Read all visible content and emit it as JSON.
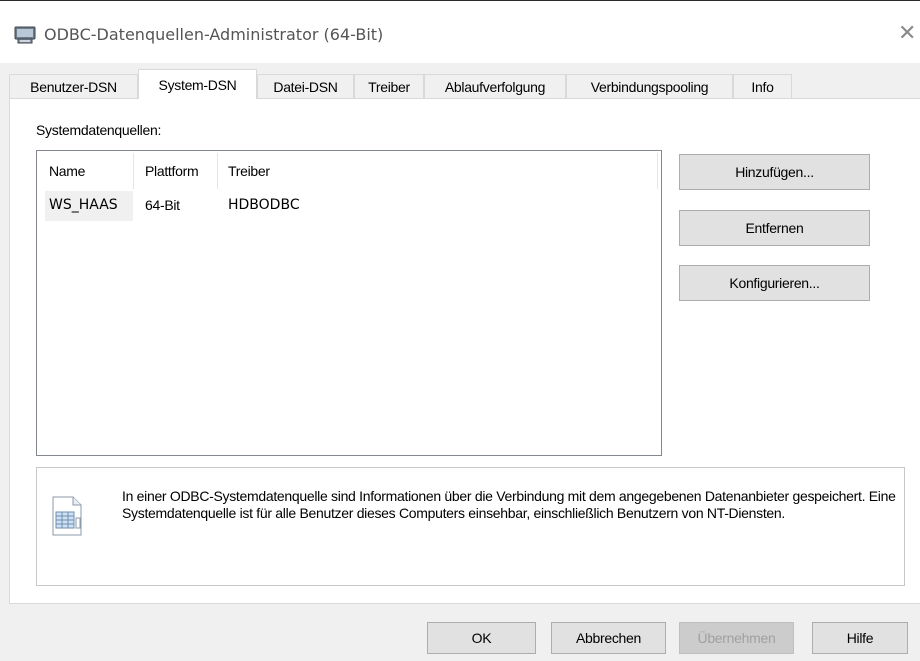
{
  "window": {
    "title": "ODBC-Datenquellen-Administrator (64-Bit)",
    "icons": {
      "app": "odbc-admin-icon",
      "close": "close-icon"
    }
  },
  "tabs": [
    {
      "label": "Benutzer-DSN",
      "active": false
    },
    {
      "label": "System-DSN",
      "active": true
    },
    {
      "label": "Datei-DSN",
      "active": false
    },
    {
      "label": "Treiber",
      "active": false
    },
    {
      "label": "Ablaufverfolgung",
      "active": false
    },
    {
      "label": "Verbindungspooling",
      "active": false
    },
    {
      "label": "Info",
      "active": false
    }
  ],
  "main": {
    "section_label": "Systemdatenquellen:",
    "table": {
      "headers": [
        "Name",
        "Plattform",
        "Treiber"
      ],
      "rows": [
        [
          "WS_HAAS",
          "64-Bit",
          "HDBODBC"
        ]
      ]
    },
    "buttons": {
      "add": "Hinzufügen...",
      "remove": "Entfernen",
      "configure": "Konfigurieren..."
    },
    "info": {
      "icon": "datasource-info-icon",
      "text": "In einer ODBC-Systemdatenquelle sind Informationen über die Verbindung mit dem angegebenen Datenanbieter gespeichert. Eine Systemdatenquelle ist für alle Benutzer dieses Computers einsehbar, einschließlich Benutzern von NT-Diensten."
    }
  },
  "footer": {
    "ok": "OK",
    "cancel": "Abbrechen",
    "apply": "Übernehmen",
    "apply_enabled": false,
    "help": "Hilfe"
  },
  "colors": {
    "dialog_bg": "#f0f0f0",
    "button_face": "#e1e1e1",
    "button_border": "#adadad"
  }
}
